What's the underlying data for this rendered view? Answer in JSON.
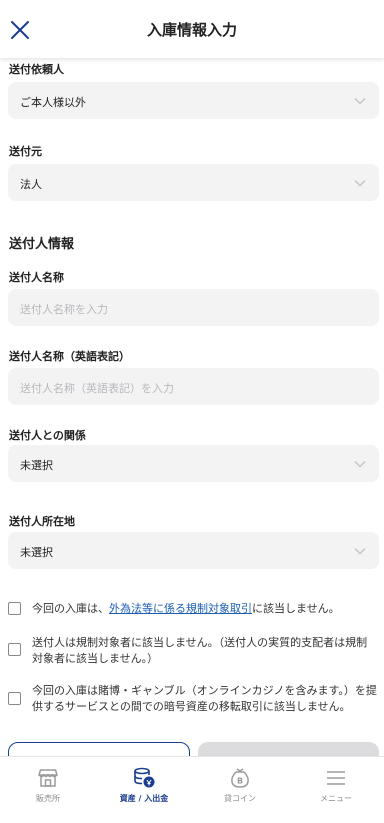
{
  "header": {
    "title": "入庫情報入力",
    "close_icon": "close-icon"
  },
  "form": {
    "sender_request": {
      "label": "送付依頼人",
      "value": "ご本人様以外"
    },
    "sender_origin": {
      "label": "送付元",
      "value": "法人"
    },
    "sender_info_heading": "送付人情報",
    "sender_name": {
      "label": "送付人名称",
      "placeholder": "送付人名称を入力"
    },
    "sender_name_en": {
      "label": "送付人名称（英語表記）",
      "placeholder": "送付人名称（英語表記）を入力"
    },
    "relationship": {
      "label": "送付人との関係",
      "value": "未選択"
    },
    "location": {
      "label": "送付人所在地",
      "value": "未選択"
    }
  },
  "checks": [
    {
      "pre": "今回の入庫は、",
      "link": "外為法等に係る規制対象取引",
      "post": "に該当しません。"
    },
    {
      "text": "送付人は規制対象者に該当しません。（送付人の実質的支配者は規制対象者に該当しません。）"
    },
    {
      "text": "今回の入庫は賭博・ギャンブル（オンラインカジノを含みます。）を提供するサービスとの間での暗号資産の移転取引に該当しません。"
    }
  ],
  "tabbar": {
    "items": [
      {
        "label": "販売所",
        "icon": "store-icon",
        "active": false
      },
      {
        "label": "資産 / 入出金",
        "icon": "coins-icon",
        "active": true
      },
      {
        "label": "貸コイン",
        "icon": "lend-coin-icon",
        "active": false
      },
      {
        "label": "メニュー",
        "icon": "menu-icon",
        "active": false
      }
    ]
  },
  "colors": {
    "accent": "#1a3d8f",
    "link": "#1a5fb4",
    "field_bg": "#f3f3f4"
  }
}
